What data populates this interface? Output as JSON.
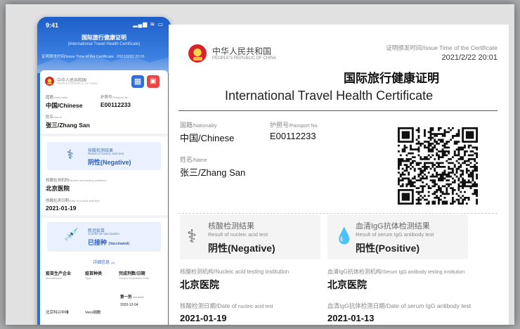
{
  "phone": {
    "status": {
      "time": "9:41",
      "icons": "▂▄▆ ≋ ▭"
    },
    "header": {
      "title": "国际旅行健康证明",
      "subtitle": "(International Travel Health Certificate)",
      "issue_line": "证明颁发时间/Issue Time of the Certificate : 2021/2/22 20:01"
    },
    "card": {
      "country_cn": "中华人民共和国",
      "country_en": "PEOPLE'S REPUBLIC OF CHINA",
      "qr_button": "▦",
      "photo_button": "▣",
      "nationality_label": "国籍",
      "nationality_label_en": "/Nationality",
      "nationality_value": "中国/Chinese",
      "passport_label": "护照号",
      "passport_label_en": "/Passport No.",
      "passport_value": "E00112233",
      "name_label": "姓名",
      "name_label_en": "/Name",
      "name_value": "张三/Zhang San",
      "nucleic": {
        "icon": "⚕",
        "title": "核酸检测结果",
        "subtitle": "Result of nucleic acid test",
        "result": "阴性(Negative)"
      },
      "institution_label": "核酸检测机构",
      "institution_label_en": "/Nucleic acid testing institution",
      "institution_value": "北京医院",
      "date_label": "核酸检测日期",
      "date_label_en": "/Date of nucleic acid test",
      "date_value": "2021-01-19",
      "vaccine": {
        "icon": "💉",
        "title": "新冠疫苗",
        "subtitle": "COVID-19 Vaccination",
        "result": "已接种",
        "result_en": "(Vaccinated)"
      },
      "detail_link": "详细信息 ︽",
      "table": {
        "headers": [
          {
            "cn": "疫苗生产企业",
            "en": "Manufacturer"
          },
          {
            "cn": "疫苗种类",
            "en": "Type"
          },
          {
            "cn": "完成剂数/日期",
            "en": "Shot(s) completed/ Date"
          }
        ],
        "shot_label": "第一剂",
        "shot_label_en": "1st shot",
        "shot_date": "2020-12-04",
        "manufacturer": "北京科兴中维",
        "type": "Vero细胞"
      }
    }
  },
  "certificate": {
    "country_cn": "中华人民共和国",
    "country_en": "PEOPLE'S REPUBLIC OF CHINA",
    "issue_label": "证明颁发时间/Issue Time of the Certificate",
    "issue_value": "2021/2/22 20:01",
    "title_cn": "国际旅行健康证明",
    "title_en": "International Travel Health Certificate",
    "nationality_label": "国籍",
    "nationality_label_en": "/Nationality",
    "nationality_value": "中国/Chinese",
    "passport_label": "护照号",
    "passport_label_en": "/Passport No.",
    "passport_value": "E00112233",
    "name_label": "姓名",
    "name_label_en": "/Name",
    "name_value": "张三/Zhang San",
    "nucleic": {
      "icon": "⚕",
      "title": "核酸检测结果",
      "subtitle": "Result of nucleic acid test",
      "result": "阴性(Negative)"
    },
    "igg": {
      "icon": "💧",
      "title": "血清IgG抗体检测结果",
      "subtitle": "Result of serum IgG antibody test",
      "result": "阳性(Positive)"
    },
    "nucleic_institution_label": "核酸检测机构",
    "nucleic_institution_label_en": "/Nucleic acid testing institution",
    "nucleic_institution_value": "北京医院",
    "igg_institution_label": "血清IgG抗体检测机构",
    "igg_institution_label_en": "/Serum IgG antibody testing institution",
    "igg_institution_value": "北京医院",
    "nucleic_date_label": "核酸检测日期",
    "nucleic_date_label_en": "/Date of",
    "nucleic_date_label_en2": " nucleic acid  test",
    "nucleic_date_value": "2021-01-19",
    "igg_date_label": "血清IgG抗体检测日期",
    "igg_date_label_en": "/Date of serum IgG antibody  test",
    "igg_date_value": "2021-01-13"
  },
  "colors": {
    "accent": "#2c6fd6",
    "box_blue": "#e8f1fd",
    "negative_blue": "#2a5fc8"
  }
}
